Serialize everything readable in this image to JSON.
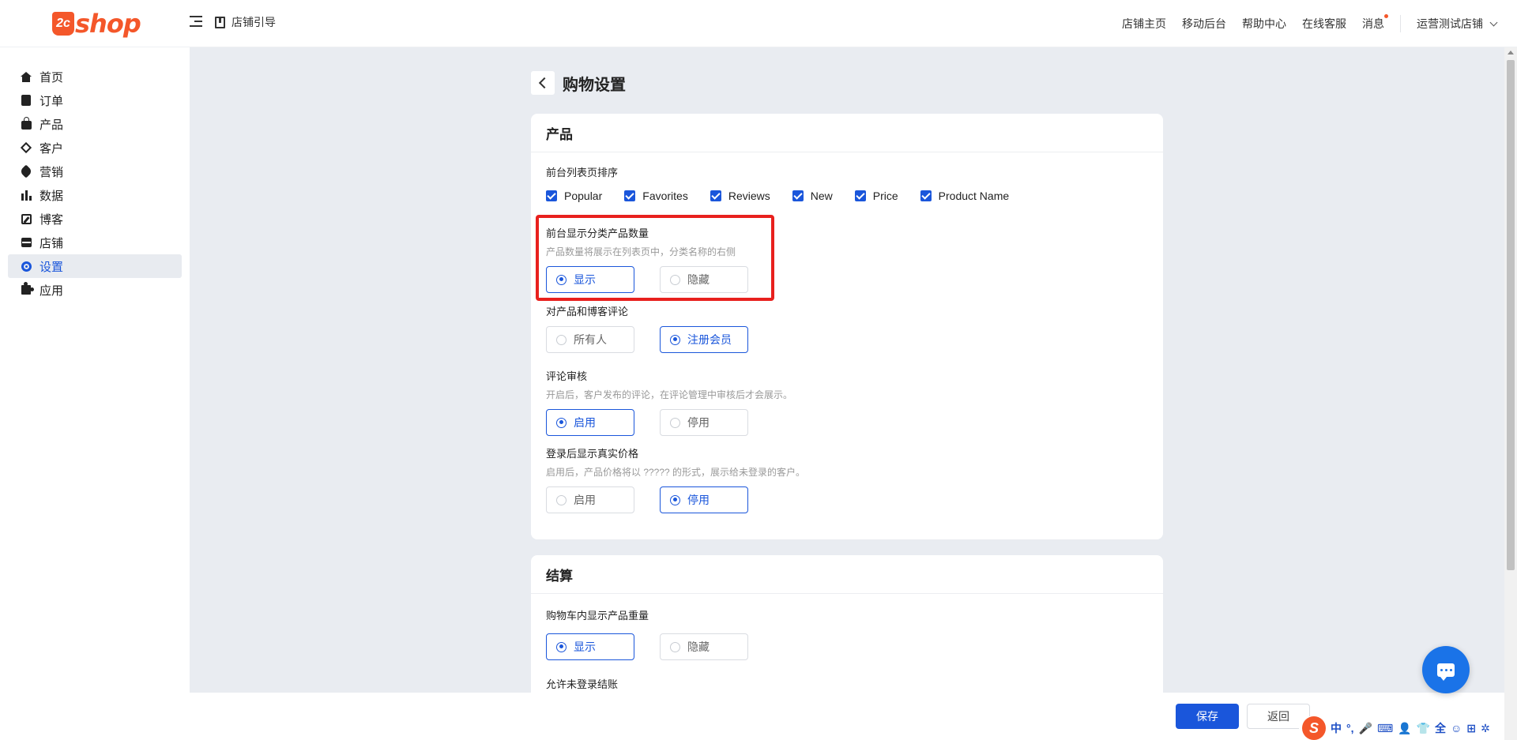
{
  "logo": {
    "badge": "2c",
    "text": "shop"
  },
  "header": {
    "guide_label": "店铺引导",
    "nav": [
      "店铺主页",
      "移动后台",
      "帮助中心",
      "在线客服",
      "消息"
    ],
    "store_name": "运营测试店铺"
  },
  "sidebar": {
    "items": [
      {
        "label": "首页",
        "icon": "home-icon"
      },
      {
        "label": "订单",
        "icon": "clipboard-icon"
      },
      {
        "label": "产品",
        "icon": "bag-icon"
      },
      {
        "label": "客户",
        "icon": "gem-icon"
      },
      {
        "label": "营销",
        "icon": "tag-icon"
      },
      {
        "label": "数据",
        "icon": "bar-chart-icon"
      },
      {
        "label": "博客",
        "icon": "edit-icon"
      },
      {
        "label": "店铺",
        "icon": "store-icon"
      },
      {
        "label": "设置",
        "icon": "gear-icon",
        "active": true
      },
      {
        "label": "应用",
        "icon": "puzzle-icon"
      }
    ]
  },
  "page": {
    "title": "购物设置"
  },
  "product_card": {
    "title": "产品",
    "sort": {
      "label": "前台列表页排序",
      "options": [
        "Popular",
        "Favorites",
        "Reviews",
        "New",
        "Price",
        "Product Name"
      ]
    },
    "show_count": {
      "label": "前台显示分类产品数量",
      "desc": "产品数量将展示在列表页中，分类名称的右侧",
      "options": [
        "显示",
        "隐藏"
      ],
      "selected": "显示"
    },
    "comment": {
      "label": "对产品和博客评论",
      "options": [
        "所有人",
        "注册会员"
      ],
      "selected": "注册会员"
    },
    "review": {
      "label": "评论审核",
      "desc": "开启后，客户发布的评论，在评论管理中审核后才会展示。",
      "options": [
        "启用",
        "停用"
      ],
      "selected": "启用"
    },
    "real_price": {
      "label": "登录后显示真实价格",
      "desc": "启用后，产品价格将以 ????? 的形式，展示给未登录的客户。",
      "options": [
        "启用",
        "停用"
      ],
      "selected": "停用"
    }
  },
  "checkout_card": {
    "title": "结算",
    "weight": {
      "label": "购物车内显示产品重量",
      "options": [
        "显示",
        "隐藏"
      ],
      "selected": "显示"
    },
    "guest_label": "允许未登录结账"
  },
  "footer": {
    "save": "保存",
    "back": "返回"
  },
  "ime": {
    "badge": "S",
    "glyphs": [
      "中",
      "°,",
      "🎤",
      "⌨",
      "👤",
      "👕",
      "全",
      "☺",
      "⊞",
      "✲"
    ]
  },
  "colors": {
    "accent": "#1a56db",
    "brand": "#f4572a",
    "highlight": "#e8201d"
  }
}
